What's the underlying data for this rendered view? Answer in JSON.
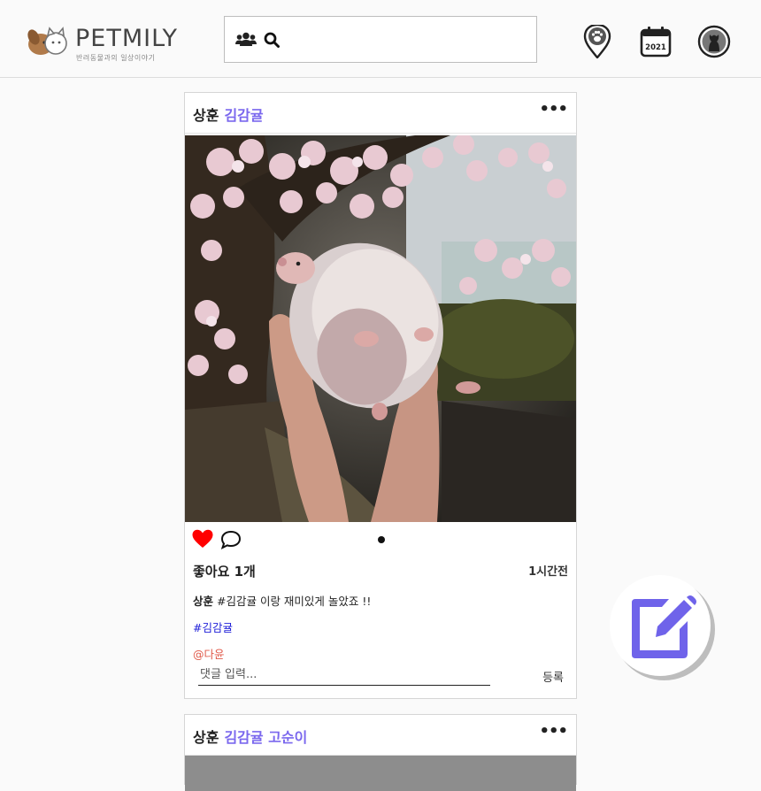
{
  "brand": {
    "name": "PETMILY",
    "tagline": "반려동물과의 일상이야기"
  },
  "search": {
    "value": "",
    "placeholder": ""
  },
  "calendar_year": "2021",
  "posts": [
    {
      "user": "상훈",
      "tags": "김감귤",
      "likes": "좋아요 1개",
      "time": "1시간전",
      "caption_user": "상훈",
      "caption_text": "#김감귤 이랑 재미있게 놀았죠 !!",
      "hashtag": "#김감귤",
      "mention": "@다윤",
      "comment_placeholder": "댓글 입력...",
      "submit_label": "등록",
      "liked": true,
      "photo_subject": "hedgehog held under cherry blossoms"
    },
    {
      "user": "상훈",
      "tags": "김감귤 고순이"
    }
  ],
  "colors": {
    "accent": "#7b68ee",
    "heart": "#ff0000",
    "hashtag": "#1e1ed8",
    "mention": "#e05a4a"
  },
  "icons": [
    "pets-logo-icon",
    "users-icon",
    "search-icon",
    "map-pin-paw-icon",
    "calendar-icon",
    "profile-cat-icon",
    "more-icon",
    "heart-icon",
    "comment-icon",
    "edit-icon"
  ]
}
